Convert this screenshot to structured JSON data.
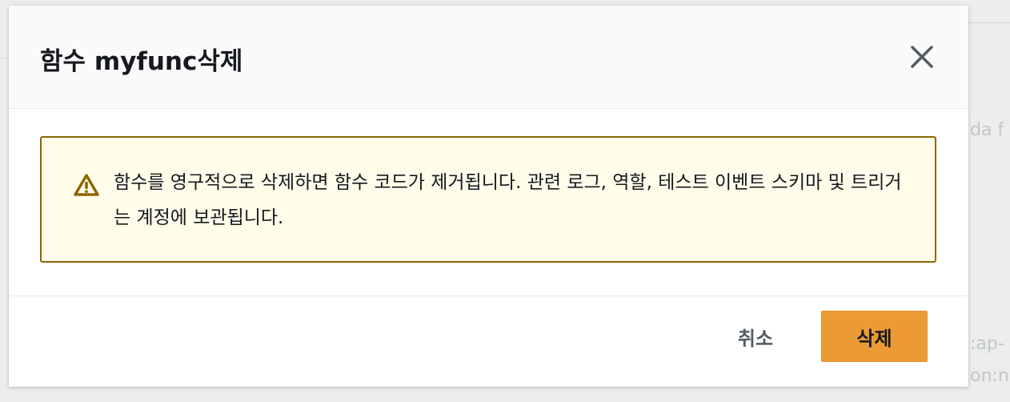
{
  "background": {
    "fragments": [
      "da f",
      ":ap-",
      "ion:n"
    ]
  },
  "modal": {
    "title": "함수 myfunc삭제",
    "close_icon": "close-icon",
    "alert": {
      "icon": "warning-icon",
      "message": "함수를 영구적으로 삭제하면 함수 코드가 제거됩니다. 관련 로그, 역할, 테스트 이벤트 스키마 및 트리거는 계정에 보관됩니다."
    },
    "footer": {
      "cancel_label": "취소",
      "delete_label": "삭제"
    }
  },
  "colors": {
    "alert_background": "#fffce9",
    "alert_border": "#8d6605",
    "primary_button": "#ec9b34"
  }
}
